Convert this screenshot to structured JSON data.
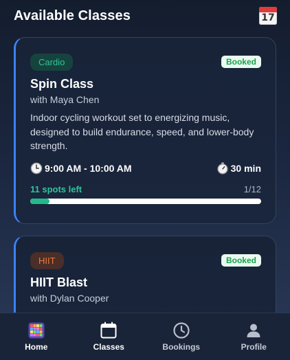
{
  "header": {
    "title": "Available Classes",
    "calendar_icon_day": "17"
  },
  "classes": [
    {
      "type": "Cardio",
      "status": "Booked",
      "name": "Spin Class",
      "instructor": "with Maya Chen",
      "description": "Indoor cycling workout set to energizing music, designed to build endurance, speed, and lower-body strength.",
      "time": "9:00 AM - 10:00 AM",
      "duration": "30 min",
      "spots_left": "11 spots left",
      "spots_count": "1/12",
      "booked_fraction": 0.0833
    },
    {
      "type": "HIIT",
      "status": "Booked",
      "name": "HIIT Blast",
      "instructor": "with Dylan Cooper"
    }
  ],
  "tabbar": {
    "items": [
      {
        "label": "Home",
        "icon": "home-grid-icon"
      },
      {
        "label": "Classes",
        "icon": "calendar-icon"
      },
      {
        "label": "Bookings",
        "icon": "clock-icon"
      },
      {
        "label": "Profile",
        "icon": "person-icon"
      }
    ]
  },
  "colors": {
    "accent": "#3b82f6",
    "success": "#2fc59a",
    "booked_text": "#15a24b",
    "hiit": "#f07a3f"
  }
}
